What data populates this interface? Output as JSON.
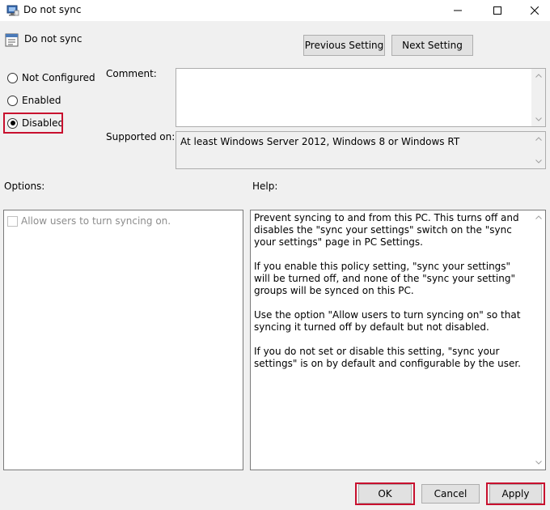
{
  "window": {
    "title": "Do not sync",
    "icons": {
      "app": "policy-editor-icon",
      "minimize": "minimize-icon",
      "maximize": "maximize-icon",
      "close": "close-icon"
    }
  },
  "header": {
    "policy_name": "Do not sync",
    "policy_icon": "policy-settings-icon",
    "previous_label": "Previous Setting",
    "next_label": "Next Setting"
  },
  "state": {
    "options": [
      {
        "label": "Not Configured",
        "checked": false
      },
      {
        "label": "Enabled",
        "checked": false
      },
      {
        "label": "Disabled",
        "checked": true
      }
    ]
  },
  "comment": {
    "label": "Comment:",
    "value": ""
  },
  "supported": {
    "label": "Supported on:",
    "value": "At least Windows Server 2012, Windows 8 or Windows RT"
  },
  "options_pane": {
    "label": "Options:",
    "checkbox_label": "Allow users to turn syncing on.",
    "checkbox_checked": false,
    "checkbox_enabled": false
  },
  "help_pane": {
    "label": "Help:",
    "paragraphs": [
      "Prevent syncing to and from this PC.  This turns off and disables the \"sync your settings\" switch on the \"sync your settings\" page in PC Settings.",
      "If you enable this policy setting, \"sync your settings\" will be turned off, and none of the \"sync your setting\" groups will be synced on this PC.",
      "Use the option \"Allow users to turn syncing on\" so that syncing it turned off by default but not disabled.",
      "If you do not set or disable this setting, \"sync your settings\" is on by default and configurable by the user."
    ]
  },
  "footer": {
    "ok_label": "OK",
    "cancel_label": "Cancel",
    "apply_label": "Apply"
  },
  "colors": {
    "highlight": "#c8102e",
    "window_bg": "#f0f0f0",
    "button_bg": "#e1e1e1",
    "disabled_text": "#8d8d8d"
  }
}
